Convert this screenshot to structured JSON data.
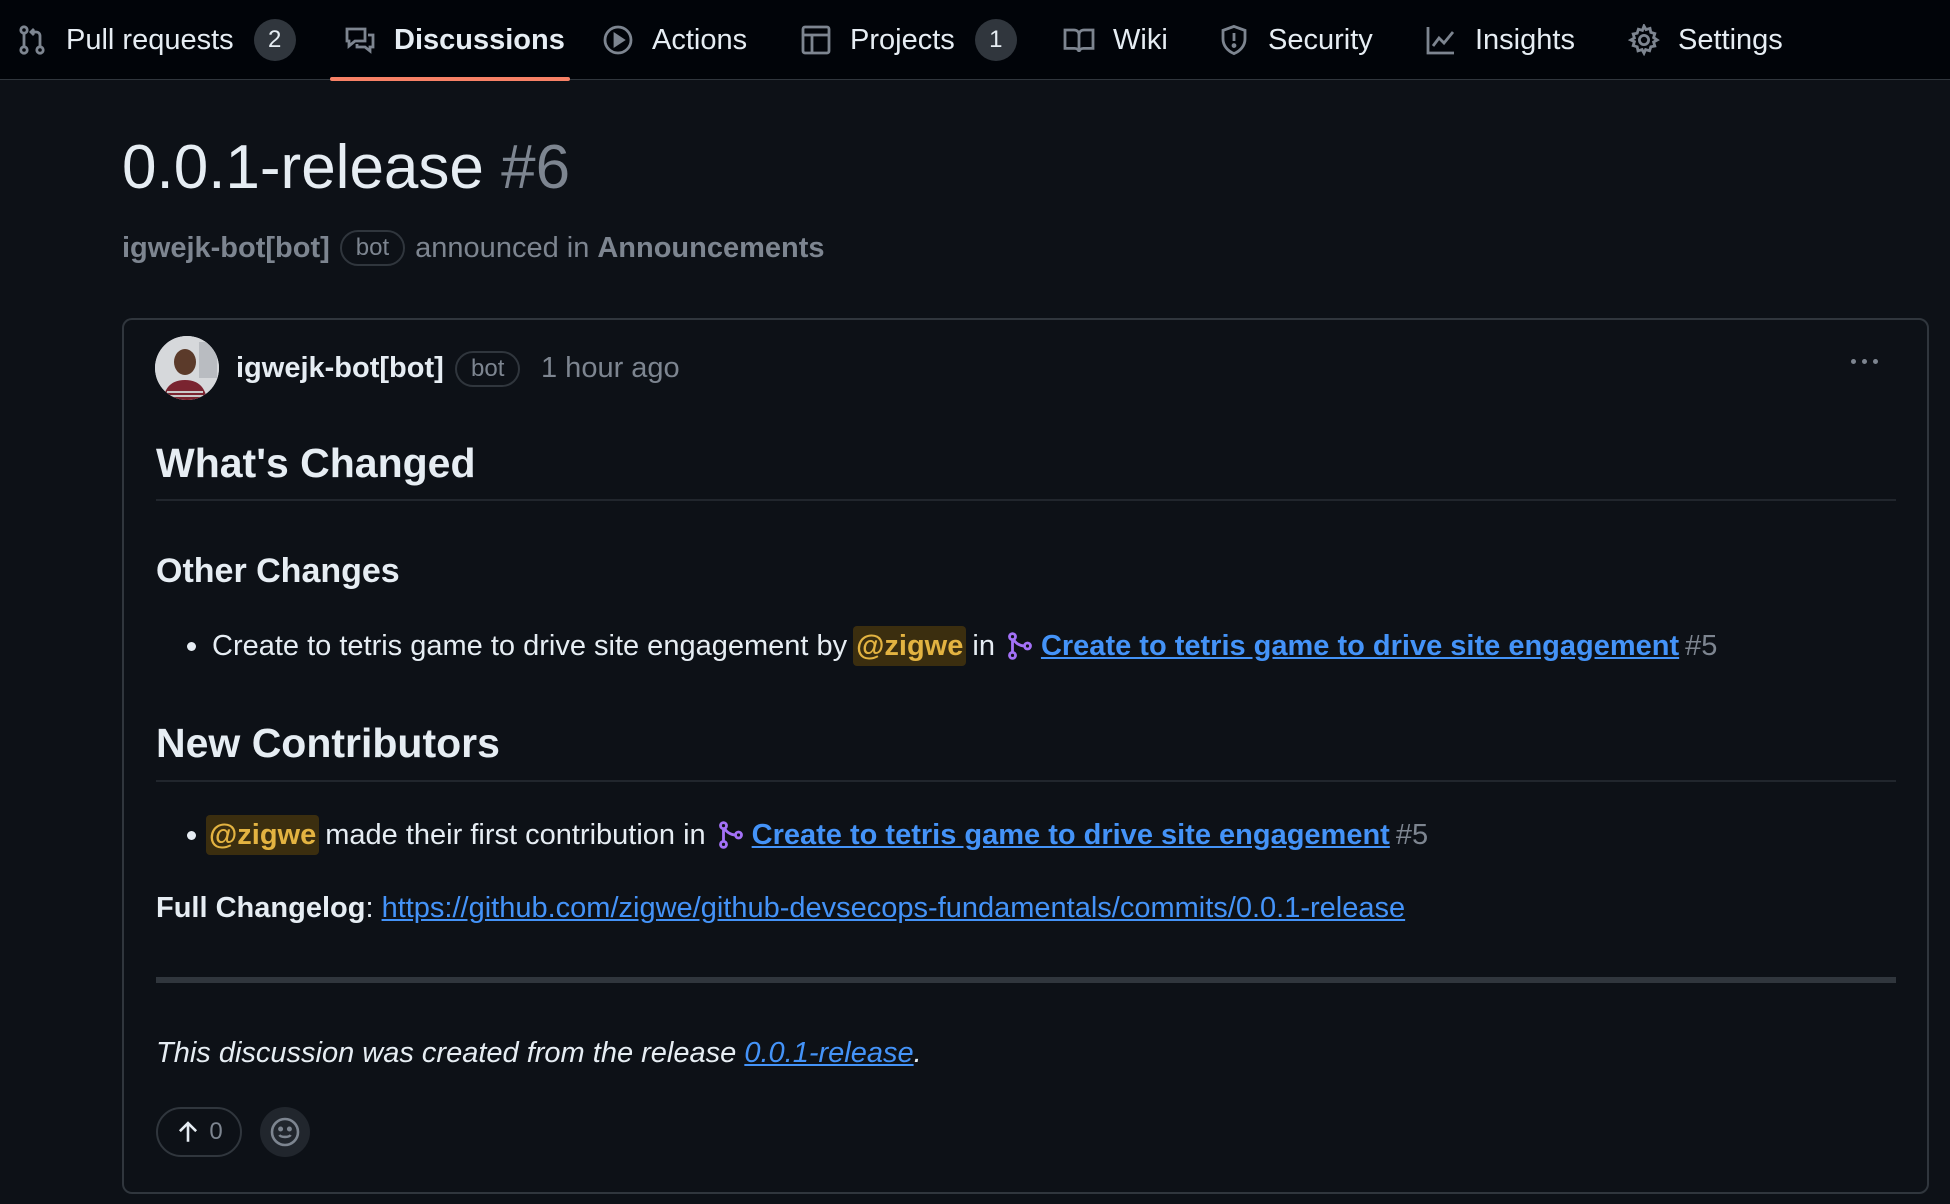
{
  "nav": {
    "tabs": [
      {
        "label": "Pull requests",
        "count": "2",
        "icon": "git-pull-request-icon"
      },
      {
        "label": "Discussions",
        "icon": "comment-discussion-icon"
      },
      {
        "label": "Actions",
        "icon": "play-icon"
      },
      {
        "label": "Projects",
        "count": "1",
        "icon": "table-icon"
      },
      {
        "label": "Wiki",
        "icon": "book-icon"
      },
      {
        "label": "Security",
        "icon": "shield-icon"
      },
      {
        "label": "Insights",
        "icon": "graph-icon"
      },
      {
        "label": "Settings",
        "icon": "gear-icon"
      }
    ],
    "selected": "Discussions"
  },
  "discussion": {
    "title": "0.0.1-release",
    "number": "#6",
    "author": "igwejk-bot[bot]",
    "author_badge": "bot",
    "announced_text": "announced in",
    "category": "Announcements"
  },
  "comment": {
    "author": "igwejk-bot[bot]",
    "badge": "bot",
    "time": "1 hour ago",
    "h_whats_changed": "What's Changed",
    "h_other_changes": "Other Changes",
    "change_item": {
      "text": "Create to tetris game to drive site engagement by",
      "mention": "@zigwe",
      "in": "in",
      "pr_title": "Create to tetris game to drive site engagement",
      "pr_number": "#5"
    },
    "h_new_contributors": "New Contributors",
    "contributor_item": {
      "mention": "@zigwe",
      "text": "made their first contribution in",
      "pr_title": "Create to tetris game to drive site engagement",
      "pr_number": "#5"
    },
    "changelog_label": "Full Changelog",
    "changelog_url": "https://github.com/zigwe/github-devsecops-fundamentals/commits/0.0.1-release",
    "footer_prefix": "This discussion was created from the release",
    "footer_link": "0.0.1-release",
    "footer_suffix": ".",
    "upvotes": "0"
  },
  "colors": {
    "background": "#0d1117",
    "nav_background": "#010409",
    "accent_underline": "#f78166",
    "link": "#4493f8",
    "muted": "#7d8590",
    "pr_icon": "#a371f7",
    "mention_bg": "#3b2e0f",
    "mention_fg": "#e3b341"
  }
}
